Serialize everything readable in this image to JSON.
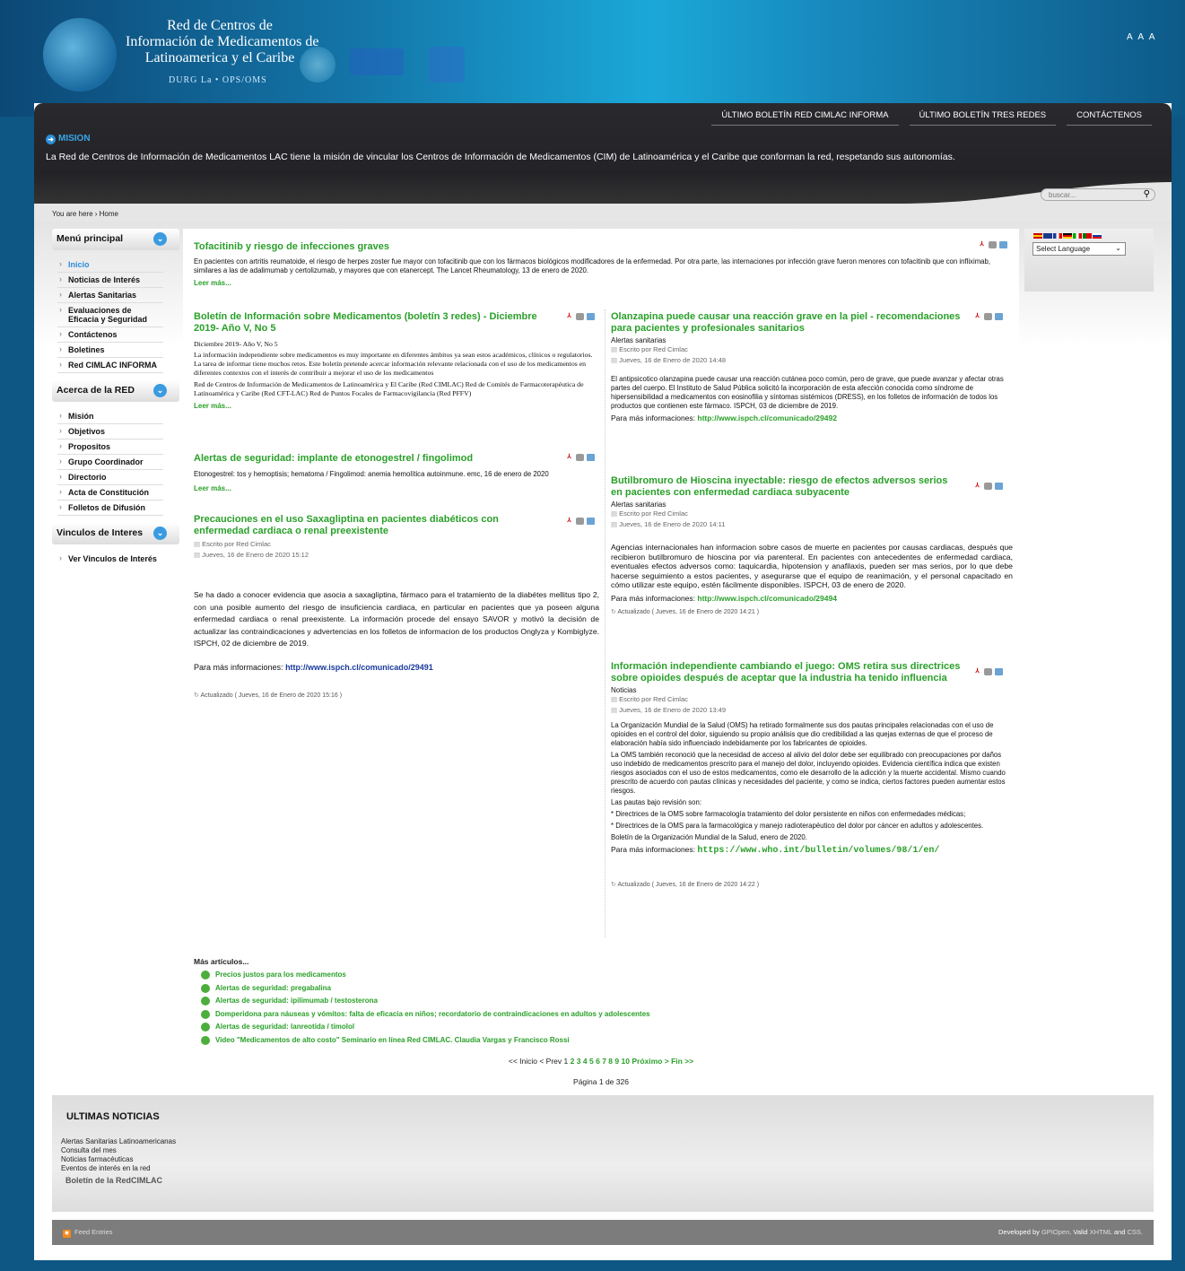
{
  "header": {
    "logo_lines": [
      "Red de Centros de",
      "Información de Medicamentos de",
      "Latinoamerica y el Caribe"
    ],
    "logo_sub": "DURG La • OPS/OMS",
    "font_controls": "A A A"
  },
  "nav": [
    "ÚLTIMO BOLETÍN RED CIMLAC INFORMA",
    "ÚLTIMO BOLETÍN TRES REDES",
    "CONTÁCTENOS"
  ],
  "mission": {
    "heading": "MISION",
    "text": "La Red de Centros de Información de Medicamentos LAC tiene la misión de vincular los Centros de Información de Medicamentos (CIM) de Latinoamérica y el Caribe que conforman la red, respetando sus autonomías."
  },
  "search": {
    "placeholder": "buscar..."
  },
  "breadcrumb": "You are here › Home",
  "sidebar": [
    {
      "title": "Menú principal",
      "items": [
        "Inicio",
        "Noticias de Interés",
        "Alertas Sanitarias",
        "Evaluaciones de Eficacia y Seguridad",
        "Contáctenos",
        "Boletines",
        "Red CIMLAC INFORMA"
      ]
    },
    {
      "title": "Acerca de la RED",
      "items": [
        "Misión",
        "Objetivos",
        "Propositos",
        "Grupo Coordinador",
        "Directorio",
        "Acta de Constitución",
        "Folletos de Difusión"
      ]
    },
    {
      "title": "Vinculos de Interes",
      "items": [
        "Ver Vinculos de Interés"
      ]
    }
  ],
  "language": {
    "select": "Select Language"
  },
  "articles": {
    "a1": {
      "title": "Tofacitinib y riesgo de infecciones graves",
      "body": "En pacientes con artritis reumatoide, el riesgo de herpes zoster fue mayor con tofacitinib que con los fármacos biológicos modificadores de la enfermedad. Por otra parte, las internaciones por infección grave fueron menores con tofacitinib que con infliximab, similares a las de adalimumab y certolizumab, y mayores que con etanercept. The Lancet Rheumatology, 13 de enero de 2020.",
      "more": "Leer más..."
    },
    "a2": {
      "title": "Boletín de Información sobre Medicamentos (boletín 3 redes) - Diciembre 2019- Año V, No 5",
      "sub": "Diciembre 2019- Año V, No 5",
      "p1": "La información independiente sobre medicamentos es muy importante en diferentes ámbitos ya sean estos académicos, clínicos o regulatorios. La tarea de informar tiene muchos retos. Este boletín pretende acercar información relevante relacionada con el uso de los medicamentos en diferentes contextos con el interés de contribuir a mejorar el uso de los medicamentos",
      "p2": "Red de Centros de Información de Medicamentos de Latinoamérica y El Caribe (Red CIMLAC) Red de Comités de Farmacoterapéutica de Latinoamérica y Caribe (Red CFT-LAC) Red de Puntos Focales de Farmacovigilancia (Red PFFV)",
      "more": "Leer más..."
    },
    "a3": {
      "title": "Alertas de seguridad: implante de etonogestrel / fingolimod",
      "body": "Etonogestrel: tos y hemoptisis; hematoma / Fingolimod: anemia hemolítica autoinmune. emc, 16 de enero de 2020",
      "more": "Leer más..."
    },
    "a4": {
      "title": "Precauciones en el uso Saxagliptina en pacientes diabéticos con enfermedad cardiaca o renal preexistente",
      "author": "Escrito por Red Cimlac",
      "date": "Jueves, 16 de Enero de 2020 15:12",
      "body": "Se ha dado a conocer evidencia que asocia a saxagliptina, fármaco para el tratamiento de la diabétes mellitus tipo 2, con una posible aumento del riesgo de insuficiencia cardiaca, en particular en pacientes que ya poseen alguna enfermedad cardiaca o renal preexistente. La información procede del ensayo SAVOR y motivó la decisión de actualizar las contraindicaciones y advertencias en los folletos de informacion de los productos Onglyza y Kombiglyze. ISPCH, 02 de diciembre de 2019.",
      "info_label": "Para más informaciones:",
      "info_link": "http://www.ispch.cl/comunicado/29491",
      "updated": "Actualizado ( Jueves, 16 de Enero de 2020 15:16 )"
    },
    "b1": {
      "title": "Olanzapina puede causar una reacción grave en la piel - recomendaciones para pacientes y profesionales sanitarios",
      "cat": "Alertas sanitarias",
      "author": "Escrito por Red Cimlac",
      "date": "Jueves, 16 de Enero de 2020 14:48",
      "body": "El antipsicotico olanzapina puede causar una reacción cutánea poco común, pero de grave, que puede avanzar y afectar otras partes del cuerpo. El Instituto de Salud Pública solicitó la incorporación de esta afección conocida como síndrome de hipersensibilidad a medicamentos con eosinofilia y síntomas sistémicos (DRESS), en los folletos de información de todos los productos que contienen este fármaco. ISPCH, 03 de diciembre de 2019.",
      "info_label": "Para más informaciones:",
      "info_link": "http://www.ispch.cl/comunicado/29492"
    },
    "b2": {
      "title": "Butilbromuro de Hioscina inyectable: riesgo de efectos adversos serios en pacientes con enfermedad cardiaca subyacente",
      "cat": "Alertas sanitarias",
      "author": "Escrito por Red Cimlac",
      "date": "Jueves, 16 de Enero de 2020 14:11",
      "body": "Agencias internacionales han informacion sobre casos de muerte en pacientes por causas cardiacas, después que recibieron butilbromuro de hioscina por via parenteral. En pacientes con antecedentes de enfermedad cardiaca, eventuales efectos adversos como: taquicardia, hipotension y anafilaxis, pueden ser mas serios, por lo que debe hacerse seguimiento a estos pacientes, y asegurarse que el equipo de reanimación, y el personal capacitado en cómo utilizar este equipo, estén fácilmente disponibles. ISPCH, 03 de enero de 2020.",
      "info_label": "Para más informaciones:",
      "info_link": "http://www.ispch.cl/comunicado/29494",
      "updated": "Actualizado ( Jueves, 16 de Enero de 2020 14:21 )"
    },
    "b3": {
      "title": "Información independiente cambiando el juego: OMS retira sus directrices sobre opioides después de aceptar que la industria ha tenido influencia",
      "cat": "Noticias",
      "author": "Escrito por Red Cimlac",
      "date": "Jueves, 16 de Enero de 2020 13:49",
      "p1": "La Organización Mundial de la Salud (OMS) ha retirado formalmente sus dos pautas principales relacionadas con el uso de opioides en el control del dolor, siguiendo su propio análisis que dio credibilidad a las quejas externas de que el proceso de elaboración había sido influenciado indebidamente por los fabricantes de opioides.",
      "p2": "La OMS también reconoció que la necesidad de acceso al alivio del dolor debe ser equilibrado con preocupaciones por daños uso indebido de medicamentos prescrito para el manejo del dolor, incluyendo opioides.  Evidencia científica indica que existen riesgos asociados con el uso de estos medicamentos, como ele desarrollo de la adicción y la muerte accidental.  Mismo cuando prescrito de acuerdo con pautas clínicas y necesidades del paciente, y como se indica, ciertos factores pueden aumentar estos riesgos.",
      "p3": "Las pautas bajo revisión son:",
      "p4": "* Directrices de la OMS sobre farmacología tratamiento del dolor persistente en niños con enfermedades médicas;",
      "p5": "* Directrices de la OMS para la farmacológica y manejo radioterapéutico del dolor por cáncer en adultos y adolescentes.",
      "p6": "Boletín de la Organización Mundial de la Salud, enero de 2020.",
      "info_label": "Para más informaciones:",
      "info_link": "https://www.who.int/bulletin/volumes/98/1/en/",
      "updated": "Actualizado ( Jueves, 16 de Enero de 2020 14:22 )"
    }
  },
  "more_articles": {
    "heading": "Más artículos...",
    "items": [
      "Precios justos para los medicamentos",
      "Alertas de seguridad: pregabalina",
      "Alertas de seguridad: ipilimumab / testosterona",
      "Domperidona para náuseas y vómitos: falta de eficacia en niños; recordatorio de contraindicaciones en adultos y adolescentes",
      "Alertas de seguridad: lanreotida / timolol",
      "Video \"Medicamentos de alto costo\" Seminario en línea Red CIMLAC. Claudia Vargas y Francisco Rossi"
    ]
  },
  "pagination": {
    "prefix": "<< Inicio < Prev",
    "current": "1",
    "pages": [
      "2",
      "3",
      "4",
      "5",
      "6",
      "7",
      "8",
      "9",
      "10"
    ],
    "next": "Próximo >",
    "last": "Fin >>",
    "page_of": "Página 1 de 326"
  },
  "news": {
    "heading": "ULTIMAS NOTICIAS",
    "items": [
      "Alertas Sanitarias Latinoamericanas",
      "Consulta del mes",
      "Noticias farmacéuticas",
      "Eventos de interés en la red"
    ],
    "bulletin": "Boletín de la RedCIMLAC"
  },
  "footer": {
    "feed": "Feed Entries",
    "credits_prefix": "Developed by",
    "credits_org": "GPIOpen",
    "valid": ". Valid",
    "xhtml": "XHTML",
    "and": "and",
    "css": "CSS."
  }
}
